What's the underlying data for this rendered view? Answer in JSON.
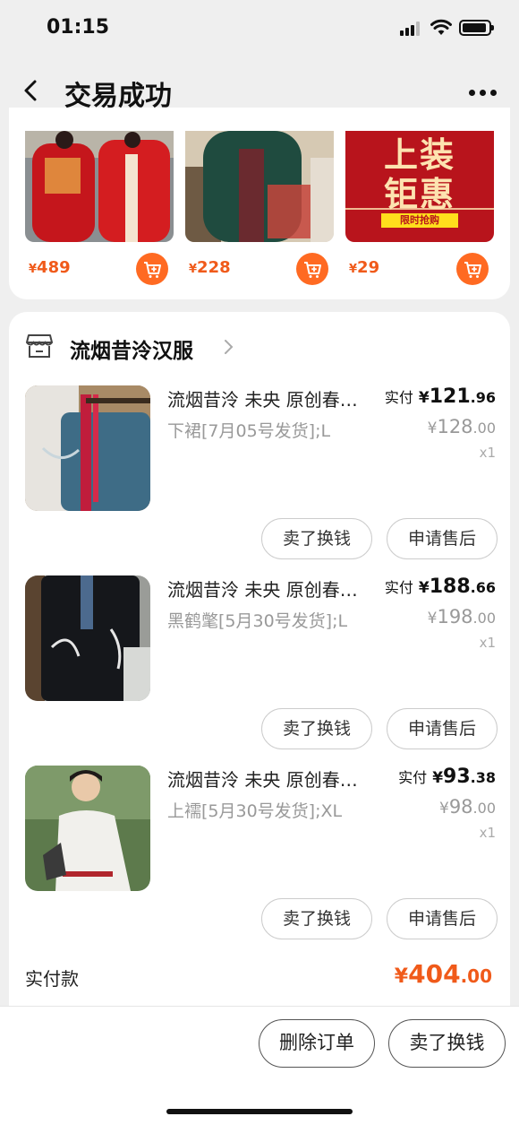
{
  "status_bar": {
    "time": "01:15"
  },
  "nav": {
    "title": "交易成功",
    "back_icon": "chevron-left-icon",
    "more_icon": "more-dots-icon"
  },
  "recommendations": [
    {
      "currency": "¥",
      "price": "489"
    },
    {
      "currency": "¥",
      "price": "228"
    },
    {
      "currency": "¥",
      "price": "29",
      "promo_line1": "上装",
      "promo_line2": "钜惠",
      "promo_tag": "限时抢购"
    }
  ],
  "shop": {
    "name": "流烟昔泠汉服",
    "icon": "store-icon"
  },
  "order_items": [
    {
      "title": "流烟昔泠 未央 原创春…",
      "sku": "下裙[7月05号发货];L",
      "paid_label": "实付",
      "paid_currency": "¥",
      "paid_int": "121",
      "paid_dec": ".96",
      "orig_currency": "¥",
      "orig_int": "128",
      "orig_dec": ".00",
      "qty": "x1",
      "sell_label": "卖了换钱",
      "after_sale_label": "申请售后"
    },
    {
      "title": "流烟昔泠 未央 原创春…",
      "sku": "黑鹤氅[5月30号发货];L",
      "paid_label": "实付",
      "paid_currency": "¥",
      "paid_int": "188",
      "paid_dec": ".66",
      "orig_currency": "¥",
      "orig_int": "198",
      "orig_dec": ".00",
      "qty": "x1",
      "sell_label": "卖了换钱",
      "after_sale_label": "申请售后"
    },
    {
      "title": "流烟昔泠 未央 原创春…",
      "sku": "上襦[5月30号发货];XL",
      "paid_label": "实付",
      "paid_currency": "¥",
      "paid_int": "93",
      "paid_dec": ".38",
      "orig_currency": "¥",
      "orig_int": "98",
      "orig_dec": ".00",
      "qty": "x1",
      "sell_label": "卖了换钱",
      "after_sale_label": "申请售后"
    }
  ],
  "total": {
    "label": "实付款",
    "currency": "¥",
    "int": "404",
    "dec": ".00"
  },
  "bottom_bar": {
    "delete_label": "删除订单",
    "sell_label": "卖了换钱"
  },
  "colors": {
    "accent": "#f05a1a",
    "cart_button": "#ff6a22",
    "promo_bg": "#b8141c",
    "page_bg": "#efefef"
  }
}
